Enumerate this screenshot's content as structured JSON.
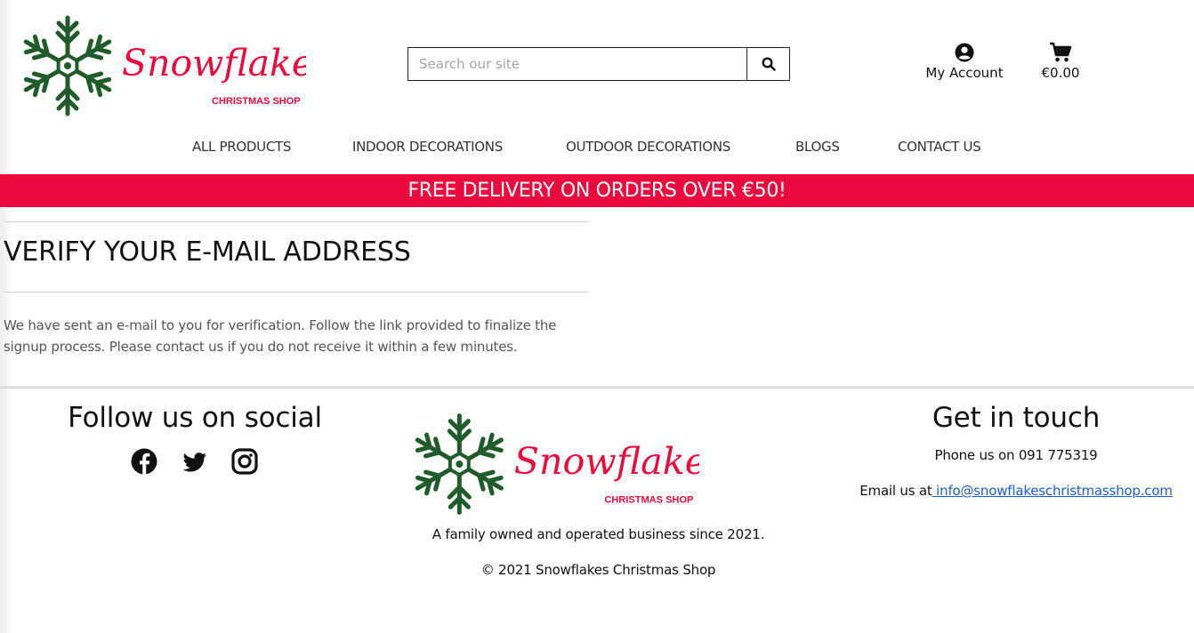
{
  "brand": {
    "name": "Snowflakes",
    "subtitle": "CHRISTMAS SHOP",
    "green": "#1f5c2a",
    "red": "#ec0a3d"
  },
  "header": {
    "search": {
      "placeholder": "Search our site",
      "value": "",
      "button_icon": "search-icon"
    },
    "account": {
      "icon": "user-circle-icon",
      "label": "My Account"
    },
    "cart": {
      "icon": "shopping-cart-icon",
      "total": "€0.00"
    }
  },
  "nav": {
    "items": [
      {
        "label": "ALL PRODUCTS"
      },
      {
        "label": "INDOOR DECORATIONS"
      },
      {
        "label": "OUTDOOR DECORATIONS"
      },
      {
        "label": "BLOGS"
      },
      {
        "label": "CONTACT US"
      }
    ]
  },
  "banner": {
    "text": "FREE DELIVERY ON ORDERS OVER €50!"
  },
  "main": {
    "title": "VERIFY YOUR E-MAIL ADDRESS",
    "message": "We have sent an e-mail to you for verification. Follow the link provided to finalize the signup process. Please contact us if you do not receive it within a few minutes."
  },
  "footer": {
    "social": {
      "title": "Follow us on social",
      "icons": [
        "facebook-icon",
        "twitter-icon",
        "instagram-icon"
      ]
    },
    "tagline": "A family owned and operated business since 2021.",
    "copyright": "© 2021 Snowflakes Christmas Shop",
    "contact": {
      "title": "Get in touch",
      "phone": "Phone us on 091 775319",
      "email_prefix": "Email us at",
      "email": " info@snowflakeschristmasshop.com"
    }
  }
}
